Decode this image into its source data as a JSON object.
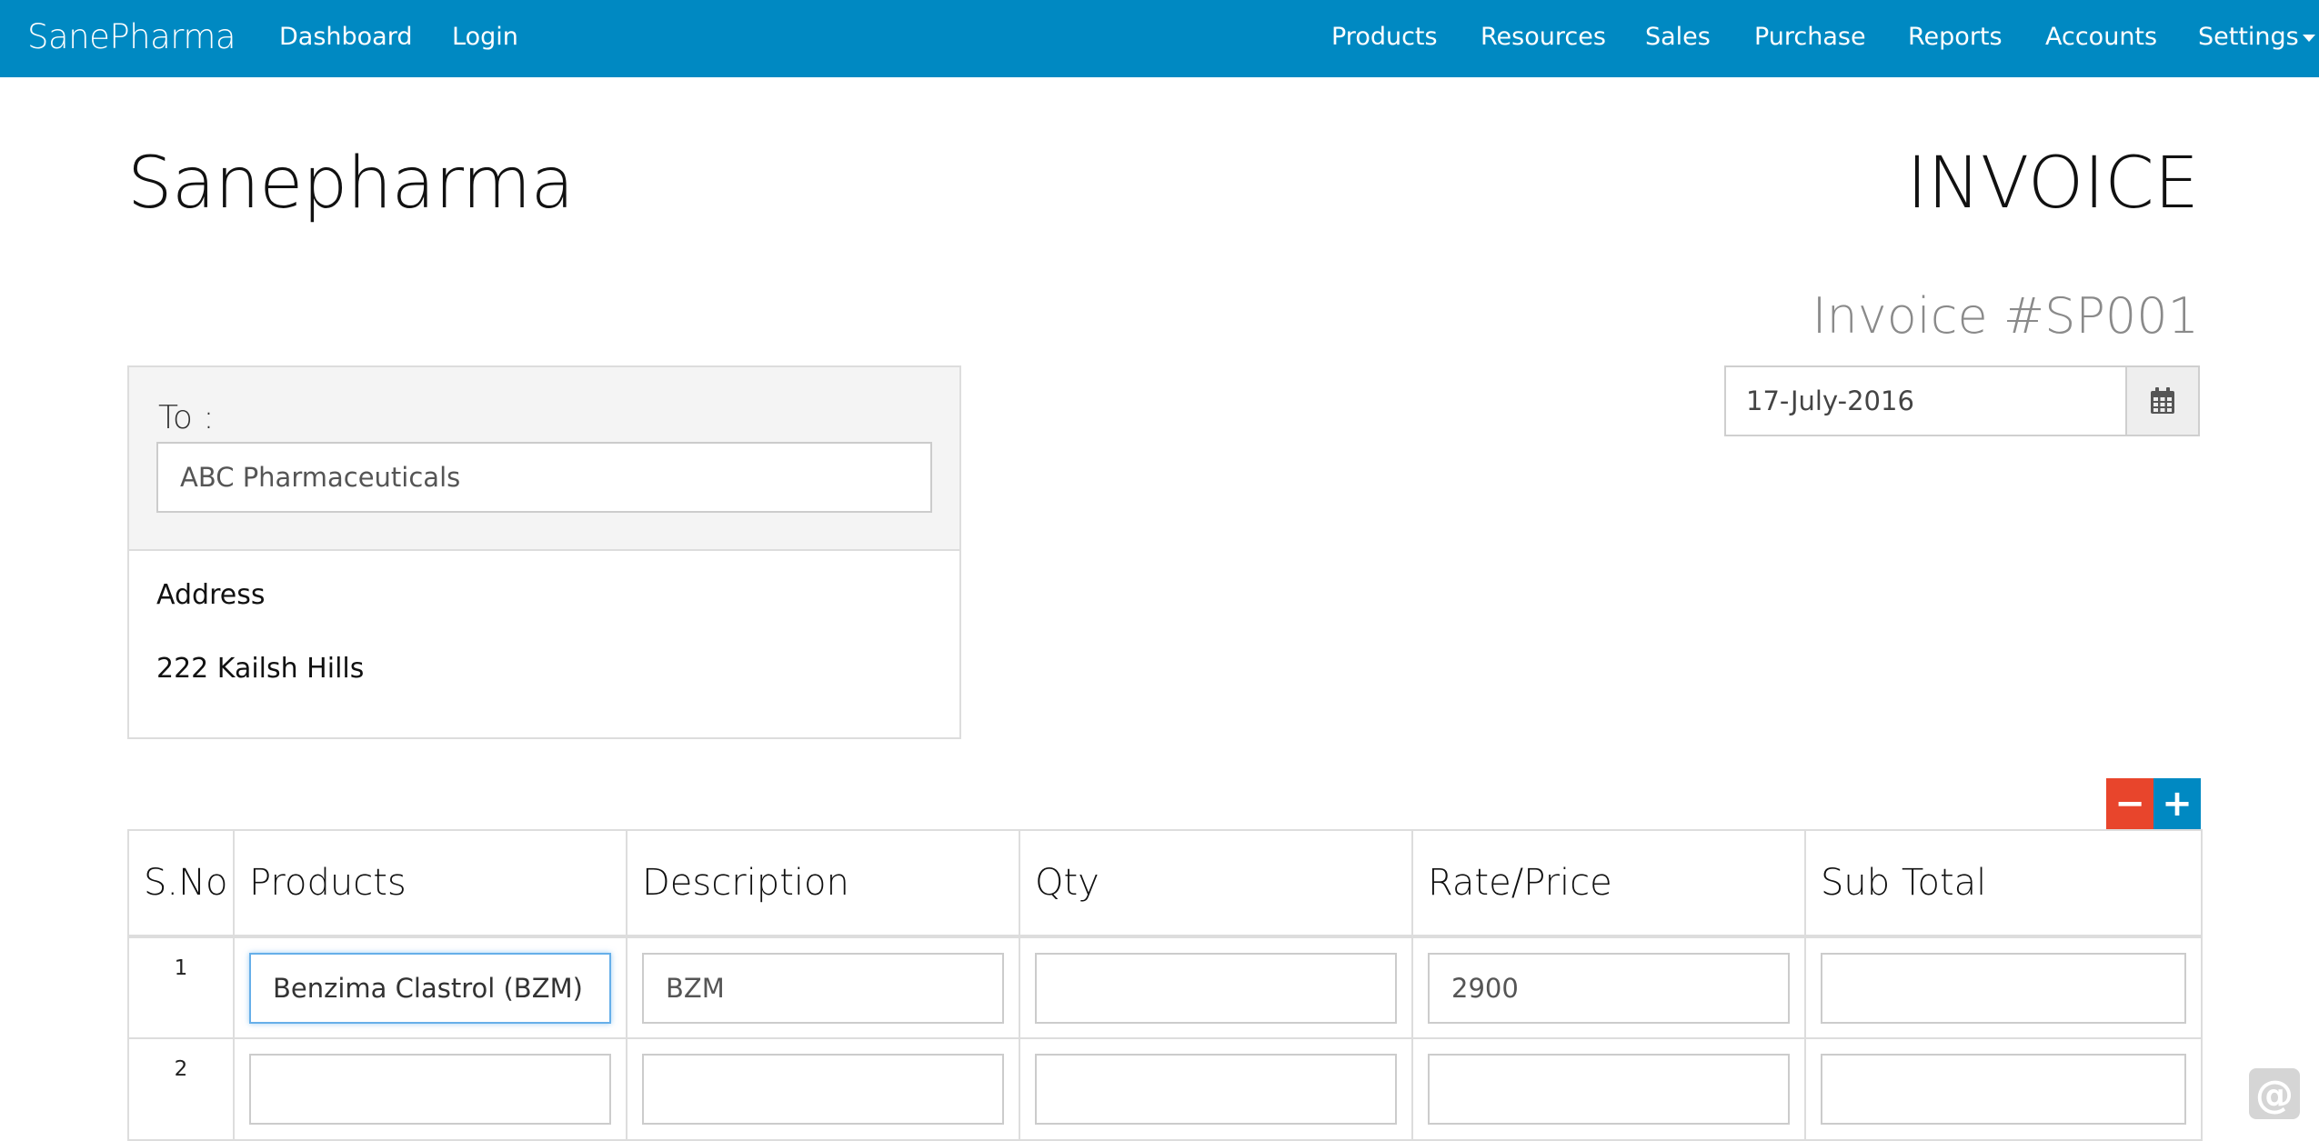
{
  "navbar": {
    "brand": "SanePharma",
    "left_links": [
      "Dashboard",
      "Login"
    ],
    "right_links": [
      "Products",
      "Resources",
      "Sales",
      "Purchase",
      "Reports",
      "Accounts",
      "Settings"
    ],
    "bg_color": "#0089c2"
  },
  "header": {
    "company": "Sanepharma",
    "doc_title": "INVOICE",
    "invoice_number": "Invoice #SP001"
  },
  "date_picker": {
    "value": "17-July-2016",
    "icon": "calendar-icon"
  },
  "customer": {
    "to_label": "To :",
    "name_value": "ABC Pharmaceuticals",
    "address_label": "Address",
    "address_value": "222 Kailsh Hills"
  },
  "row_controls": {
    "remove_symbol": "−",
    "add_symbol": "+",
    "remove_color": "#e8452c",
    "add_color": "#0089c2"
  },
  "table": {
    "columns": [
      "S.No",
      "Products",
      "Description",
      "Qty",
      "Rate/Price",
      "Sub Total"
    ],
    "rows": [
      {
        "sno": "1",
        "product": "Benzima Clastrol (BZM)",
        "description": "BZM",
        "qty": "",
        "rate": "2900",
        "subtotal": ""
      },
      {
        "sno": "2",
        "product": "",
        "description": "",
        "qty": "",
        "rate": "",
        "subtotal": ""
      }
    ]
  },
  "help_widget": {
    "symbol": "@"
  }
}
